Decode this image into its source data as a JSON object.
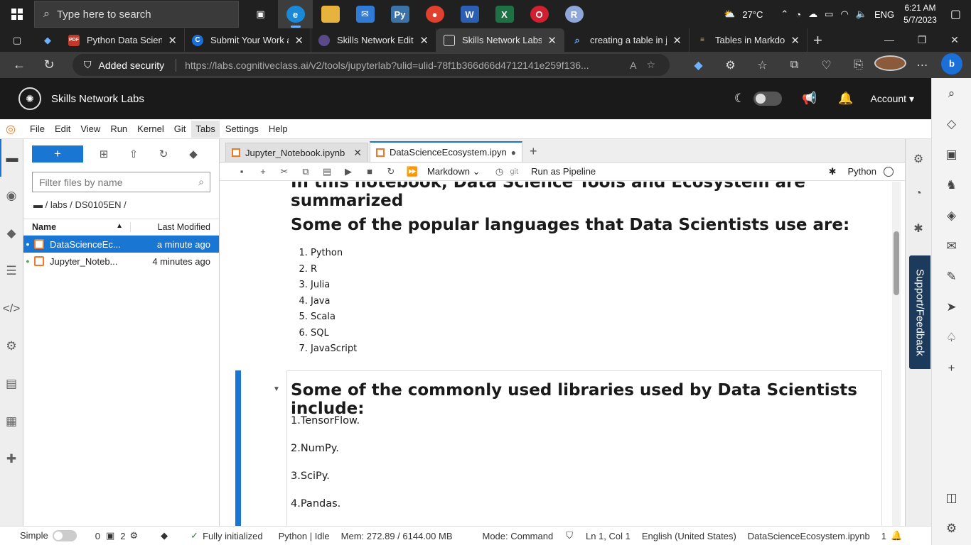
{
  "taskbar": {
    "search_placeholder": "Type here to search",
    "apps": [
      "task-view",
      "edge",
      "file-explorer",
      "mail",
      "python",
      "chrome",
      "word",
      "excel",
      "opera",
      "r-app"
    ],
    "weather": "27°C",
    "language": "ENG",
    "time": "6:21 AM",
    "date": "5/7/2023"
  },
  "browser": {
    "tabs": [
      {
        "label": "Python Data Science",
        "fav_color": "#c0392b",
        "fav_text": "PDF"
      },
      {
        "label": "Submit Your Work an",
        "fav_color": "#1a6fd8",
        "fav_text": "C"
      },
      {
        "label": "Skills Network Editor",
        "fav_color": "#5a4a8a",
        "fav_text": "S"
      },
      {
        "label": "Skills Network Labs",
        "fav_color": "#555555",
        "fav_text": ""
      },
      {
        "label": "creating a table in jup",
        "fav_color": "#1a6fd8",
        "fav_text": "Q"
      },
      {
        "label": "Tables in Markdown (",
        "fav_color": "#e8a33d",
        "fav_text": "S"
      }
    ],
    "security_label": "Added security",
    "url": "https://labs.cognitiveclass.ai/v2/tools/jupyterlab?ulid=ulid-78f1b366d66d4712141e259f136..."
  },
  "header": {
    "title": "Skills Network Labs",
    "account_label": "Account"
  },
  "menu": [
    "File",
    "Edit",
    "View",
    "Run",
    "Kernel",
    "Git",
    "Tabs",
    "Settings",
    "Help"
  ],
  "filebrowser": {
    "new_label": "+",
    "filter_placeholder": "Filter files by name",
    "breadcrumb": "/ labs / DS0105EN /",
    "col_name": "Name",
    "col_modified": "Last Modified",
    "files": [
      {
        "name": "DataScienceEc...",
        "modified": "a minute ago"
      },
      {
        "name": "Jupyter_Noteb...",
        "modified": "4 minutes ago"
      }
    ]
  },
  "doc_tabs": [
    {
      "label": "Jupyter_Notebook.ipynb"
    },
    {
      "label": "DataScienceEcosystem.ipyn"
    }
  ],
  "nb_toolbar": {
    "cell_type": "Markdown",
    "git_label": "git",
    "pipeline_label": "Run as Pipeline",
    "kernel_label": "Python"
  },
  "notebook": {
    "partial_heading": "In this notebook, Data Science Tools and Ecosystem are summarized",
    "languages_heading": "Some of the popular languages that Data Scientists use are:",
    "languages": [
      "Python",
      "R",
      "Julia",
      "Java",
      "Scala",
      "SQL",
      "JavaScript"
    ],
    "libraries_heading": "Some of the commonly used libraries used by Data Scientists include:",
    "libraries": [
      "1.TensorFlow.",
      "2.NumPy.",
      "3.SciPy.",
      "4.Pandas."
    ]
  },
  "support_label": "Support/Feedback",
  "statusbar": {
    "mode_simple": "Simple",
    "count_a": "0",
    "count_b": "2",
    "init_status": "Fully initialized",
    "kernel_status": "Python | Idle",
    "memory": "Mem: 272.89 / 6144.00 MB",
    "mode": "Mode: Command",
    "position": "Ln 1, Col 1",
    "language": "English (United States)",
    "filename": "DataScienceEcosystem.ipynb",
    "notif_count": "1"
  }
}
